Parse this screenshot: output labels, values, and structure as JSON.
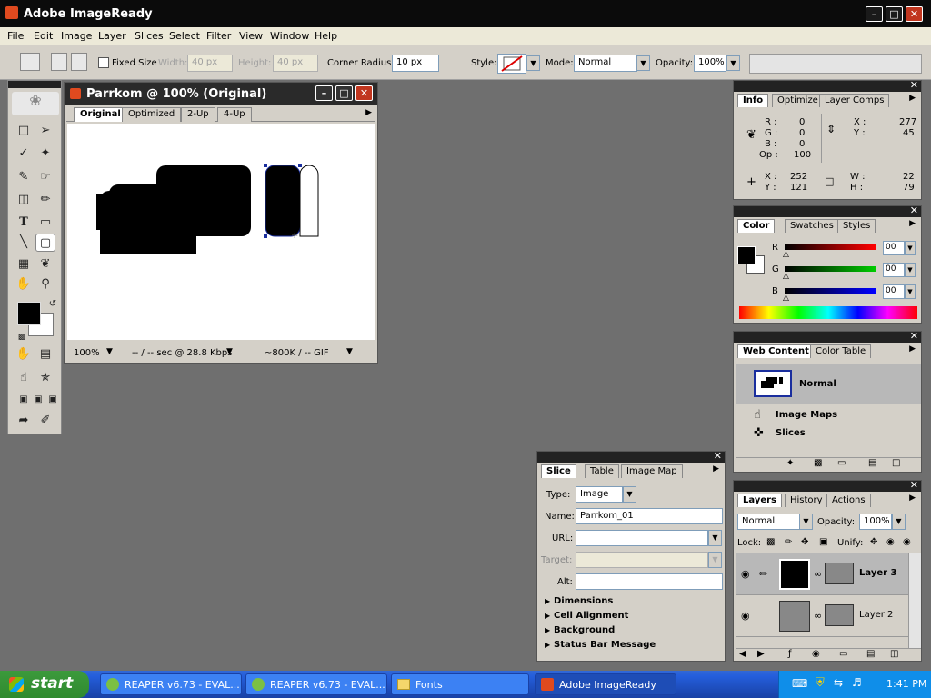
{
  "window": {
    "title": "Adobe ImageReady"
  },
  "menu": [
    "File",
    "Edit",
    "Image",
    "Layer",
    "Slices",
    "Select",
    "Filter",
    "View",
    "Window",
    "Help"
  ],
  "options": {
    "fixed_size_label": "Fixed Size",
    "width_label": "Width:",
    "width_value": "40 px",
    "height_label": "Height:",
    "height_value": "40 px",
    "corner_radius_label": "Corner Radius:",
    "corner_radius_value": "10 px",
    "style_label": "Style:",
    "mode_label": "Mode:",
    "mode_value": "Normal",
    "opacity_label": "Opacity:",
    "opacity_value": "100%"
  },
  "document": {
    "title": "Parrkom @ 100% (Original)",
    "tabs": [
      "Original",
      "Optimized",
      "2-Up",
      "4-Up"
    ],
    "active_tab": "Original",
    "zoom": "100%",
    "download": "-- / -- sec @ 28.8 Kbps",
    "size": "~800K / -- GIF"
  },
  "info_panel": {
    "tabs": [
      "Info",
      "Optimize",
      "Layer Comps"
    ],
    "r_label": "R :",
    "r": "0",
    "g_label": "G :",
    "g": "0",
    "b_label": "B :",
    "b": "0",
    "op_label": "Op :",
    "op": "100",
    "x1_label": "X :",
    "x1": "277",
    "y1_label": "Y :",
    "y1": "45",
    "x2_label": "X :",
    "x2": "252",
    "y2_label": "Y :",
    "y2": "121",
    "w_label": "W :",
    "w": "22",
    "h_label": "H :",
    "h": "79"
  },
  "color_panel": {
    "tabs": [
      "Color",
      "Swatches",
      "Styles"
    ],
    "r_label": "R",
    "r": "00",
    "g_label": "G",
    "g": "00",
    "b_label": "B",
    "b": "00"
  },
  "web_content_panel": {
    "tabs": [
      "Web Content",
      "Color Table"
    ],
    "state": "Normal",
    "image_maps": "Image Maps",
    "slices": "Slices"
  },
  "slice_panel": {
    "tabs": [
      "Slice",
      "Table",
      "Image Map"
    ],
    "type_label": "Type:",
    "type_value": "Image",
    "name_label": "Name:",
    "name_value": "Parrkom_01",
    "url_label": "URL:",
    "url_value": "",
    "target_label": "Target:",
    "target_value": "",
    "alt_label": "Alt:",
    "alt_value": "",
    "sections": [
      "Dimensions",
      "Cell Alignment",
      "Background",
      "Status Bar Message"
    ]
  },
  "layers_panel": {
    "tabs": [
      "Layers",
      "History",
      "Actions"
    ],
    "blend_mode": "Normal",
    "opacity_label": "Opacity:",
    "opacity_value": "100%",
    "lock_label": "Lock:",
    "unify_label": "Unify:",
    "layers": [
      "Layer 3",
      "Layer 2"
    ]
  },
  "taskbar": {
    "start": "start",
    "items": [
      "REAPER v6.73 - EVAL...",
      "REAPER v6.73 - EVAL...",
      "Fonts",
      "Adobe ImageReady"
    ],
    "clock": "1:41 PM"
  },
  "colors": {
    "panel_bg": "#d4d0c8",
    "workspace": "#6f6f6f",
    "taskbar_blue": "#245edb",
    "start_green": "#2f8a2f"
  }
}
